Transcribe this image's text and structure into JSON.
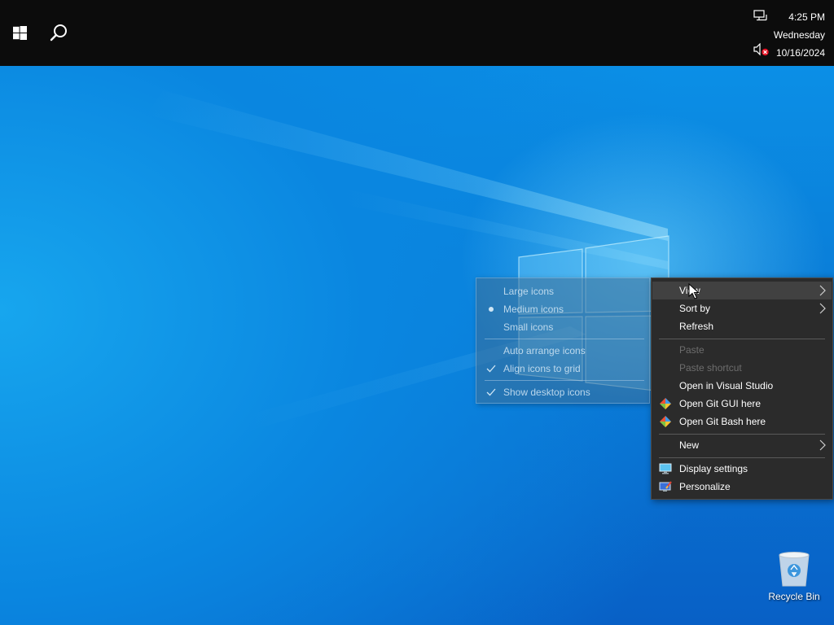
{
  "taskbar": {
    "time": "4:25 PM",
    "weekday": "Wednesday",
    "date": "10/16/2024"
  },
  "view_submenu": {
    "items": [
      {
        "label": "Large icons",
        "mark": ""
      },
      {
        "label": "Medium icons",
        "mark": "bullet"
      },
      {
        "label": "Small icons",
        "mark": ""
      },
      {
        "label": "Auto arrange icons",
        "mark": ""
      },
      {
        "label": "Align icons to grid",
        "mark": "check"
      },
      {
        "label": "Show desktop icons",
        "mark": "check"
      }
    ]
  },
  "context_menu": {
    "items": [
      {
        "label": "View",
        "submenu": true,
        "state": "hover"
      },
      {
        "label": "Sort by",
        "submenu": true
      },
      {
        "label": "Refresh"
      },
      {
        "label": "Paste",
        "state": "disabled"
      },
      {
        "label": "Paste shortcut",
        "state": "disabled"
      },
      {
        "label": "Open in Visual Studio"
      },
      {
        "label": "Open Git GUI here",
        "icon": "git-icon"
      },
      {
        "label": "Open Git Bash here",
        "icon": "git-icon"
      },
      {
        "label": "New",
        "submenu": true
      },
      {
        "label": "Display settings",
        "icon": "monitor-icon"
      },
      {
        "label": "Personalize",
        "icon": "personalize-icon"
      }
    ]
  },
  "desktop": {
    "recycle_bin_label": "Recycle Bin"
  },
  "colors": {
    "taskbar": "#0c0c0c",
    "menu_bg": "#2b2b2b",
    "menu_hover": "#414141",
    "menu_disabled_text": "#6d6d6d",
    "desktop_blue": "#0a7fd9"
  }
}
